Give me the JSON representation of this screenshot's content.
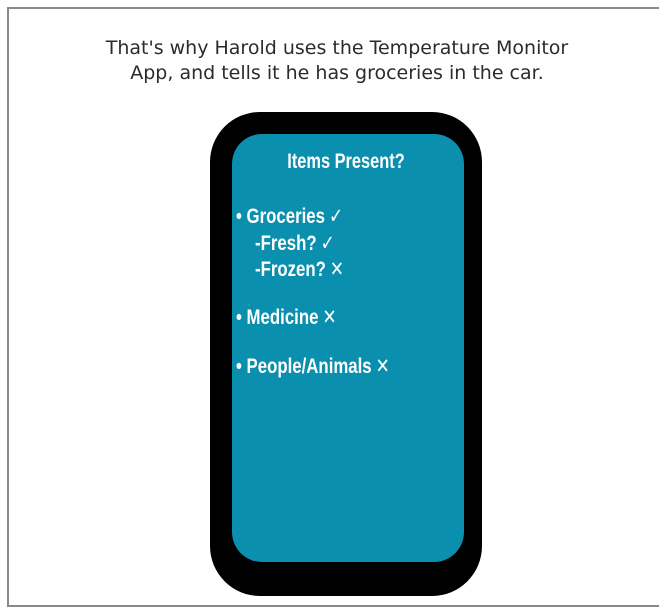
{
  "caption": {
    "line1": "That's why Harold uses the Temperature Monitor",
    "line2": "App, and tells it he has groceries in the car."
  },
  "phone": {
    "title": "Items Present?",
    "items": [
      {
        "label": "• Groceries",
        "mark": "✓"
      },
      {
        "label": "-Fresh?",
        "mark": "✓"
      },
      {
        "label": "-Frozen?",
        "mark": "✕"
      },
      {
        "label": "• Medicine",
        "mark": "✕"
      },
      {
        "label": "• People/Animals",
        "mark": "✕"
      }
    ]
  },
  "colors": {
    "screen": "#0b8fae",
    "phone_body": "#000000",
    "text": "#ffffff"
  },
  "icons": {
    "check": "check-icon",
    "cross": "cross-icon"
  }
}
